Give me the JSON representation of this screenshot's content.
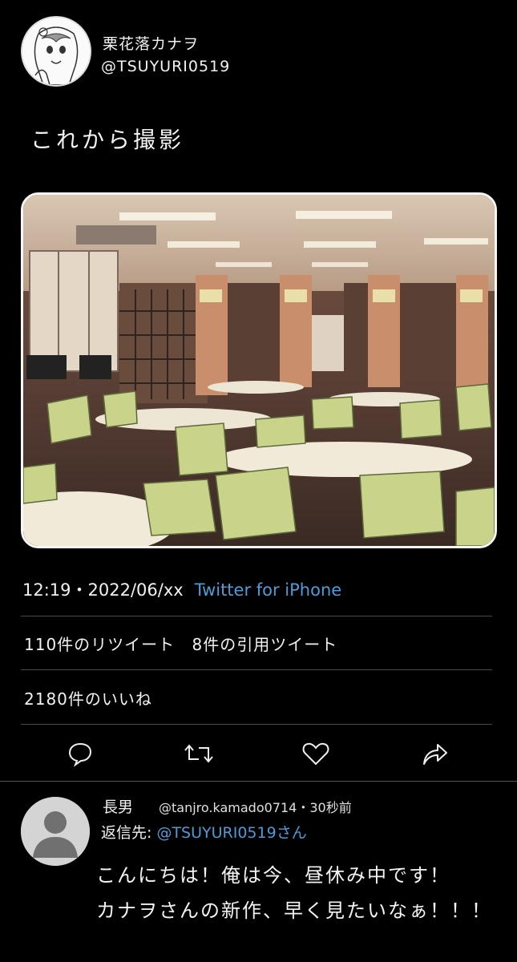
{
  "tweet": {
    "author_name": "栗花落カナヲ",
    "author_handle": "@TSUYURI0519",
    "text": "これから撮影",
    "time": "12:19",
    "separator": "・",
    "date": "2022/06/xx",
    "source": "Twitter for iPhone",
    "retweets_text": "110件のリツイート",
    "quotes_text": "8件の引用ツイート",
    "likes_text": "2180件のいいね"
  },
  "actions": {
    "reply_icon": "reply-icon",
    "retweet_icon": "retweet-icon",
    "like_icon": "heart-icon",
    "share_icon": "share-icon"
  },
  "reply": {
    "name": "長男",
    "handle": "@tanjro.kamado0714",
    "separator": "・",
    "time_ago": "30秒前",
    "reply_to_label": "返信先:",
    "reply_to_handle": "@TSUYURI0519",
    "reply_to_suffix": "さん",
    "line1": "こんにちは！俺は今、昼休み中です！",
    "line2": "カナヲさんの新作、早く見たいなぁ！！！"
  },
  "colors": {
    "background": "#000000",
    "link": "#4e9bd8",
    "divider": "#4a4a4a"
  }
}
